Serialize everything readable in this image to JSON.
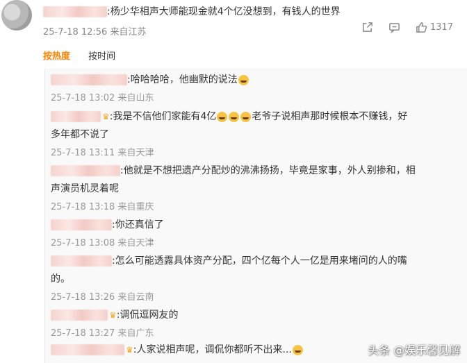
{
  "main_comment": {
    "text": ":杨少华相声大师能现金就4个亿没想到，有钱人的世界",
    "timestamp": "25-7-18 12:56",
    "location": "来自江苏",
    "like_count": "1317"
  },
  "sort_tabs": [
    {
      "label": "按热度",
      "active": true
    },
    {
      "label": "按时间",
      "active": false
    }
  ],
  "replies": [
    {
      "text": ":哈哈哈哈，他幽默的说法",
      "emoji_after": 1,
      "timestamp": "25-7-18 13:02",
      "location": "来自山东"
    },
    {
      "text_part1": ":我是不信他们家能有4亿",
      "text_part2": "老爷子说相声那时候根本不赚钱，好",
      "text_line2": "多年都不说了",
      "timestamp": "25-7-18 13:11",
      "location": "来自天津"
    },
    {
      "text": ":他就是不想把遗产分配炒的沸沸扬扬，毕竟是家事，外人别掺和，相",
      "text_line2": "声演员机灵着呢",
      "timestamp": "25-7-18 13:18",
      "location": "来自重庆"
    },
    {
      "text": ":你还真信了",
      "timestamp": "25-7-18 13:08",
      "location": "来自天津"
    },
    {
      "text": ":怎么可能透露具体资产分配，四个亿每个人一亿是用来堵问的人的嘴",
      "text_line2": "的。",
      "timestamp": "25-7-18 13:26",
      "location": "来自云南"
    },
    {
      "text": ":调侃逗网友的",
      "timestamp": "25-7-18 13:27",
      "location": "来自广东"
    },
    {
      "text": ":人家说相声呢，调侃你都听不出来...",
      "timestamp": "",
      "location": ""
    }
  ],
  "watermark": "头条 @娱乐馨见解",
  "colors": {
    "accent": "#ff8200",
    "meta": "#999999"
  }
}
